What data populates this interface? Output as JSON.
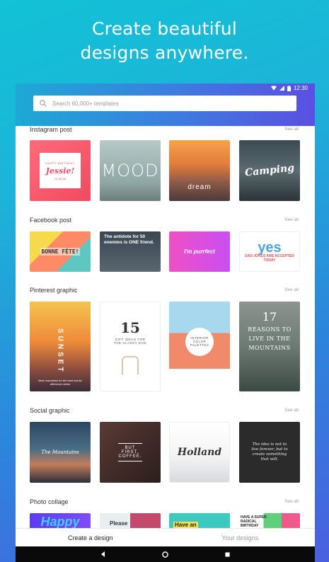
{
  "hero": {
    "line1": "Create beautiful",
    "line2": "designs anywhere."
  },
  "status": {
    "time": "12:30"
  },
  "search": {
    "placeholder": "Search 60,000+ templates"
  },
  "sections": [
    {
      "title": "Instagram post",
      "see_all": "See all",
      "tiles": [
        {
          "lines": [
            "HAPPY BIRTHDAY",
            "Jessie!",
            "01.05.26"
          ]
        },
        {
          "lines": [
            "MOOD"
          ]
        },
        {
          "lines": [
            "dream"
          ]
        },
        {
          "lines": [
            "Camping"
          ]
        }
      ]
    },
    {
      "title": "Facebook post",
      "see_all": "See all",
      "tiles": [
        {
          "lines": [
            "BONNE FÊTE!"
          ]
        },
        {
          "lines": [
            "The antidote for 50 enemies is ONE friend."
          ]
        },
        {
          "lines": [
            "I'm purrfect"
          ]
        },
        {
          "lines": [
            "yes",
            "DAD JOKES ARE ACCEPTED TODAY"
          ]
        }
      ]
    },
    {
      "title": "Pinterest graphic",
      "see_all": "See all",
      "tiles": [
        {
          "lines": [
            "SUNSET",
            "Best mountains for the best scenic afternoon views"
          ]
        },
        {
          "lines": [
            "15",
            "GIFT IDEAS FOR THE CLASSY DAD"
          ]
        },
        {
          "lines": [
            "INTERIOR COLOR PALETTES"
          ]
        },
        {
          "lines": [
            "17",
            "REASONS TO LIVE IN THE MOUNTAINS"
          ]
        }
      ]
    },
    {
      "title": "Social graphic",
      "see_all": "See all",
      "tiles": [
        {
          "lines": [
            "The Mountains"
          ]
        },
        {
          "lines": [
            "BUT FIRST, COFFEE."
          ]
        },
        {
          "lines": [
            "Holland"
          ]
        },
        {
          "lines": [
            "The idea is not to live forever, but to create something that will."
          ]
        }
      ]
    },
    {
      "title": "Photo collage",
      "see_all": "See all",
      "tiles": [
        {
          "lines": [
            "Happy"
          ]
        },
        {
          "lines": [
            "Please"
          ]
        },
        {
          "lines": [
            "Have an"
          ]
        },
        {
          "lines": [
            "HAVE A SUPER RADICAL BIRTHDAY"
          ]
        }
      ]
    }
  ],
  "bottom_nav": {
    "tab1": "Create a design",
    "tab2": "Your designs"
  },
  "colors": {
    "gradient_start": "#1da9d4",
    "gradient_end": "#5b4fe2",
    "nav_bg": "#0a0a0a"
  }
}
